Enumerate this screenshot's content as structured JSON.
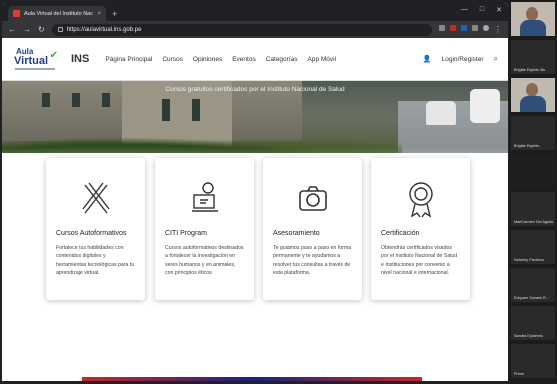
{
  "browser": {
    "tab_title": "Aula Virtual del Instituto Nacion",
    "tab_close": "×",
    "new_tab": "+",
    "url": "https://aulavirtual.ins.gob.pe"
  },
  "site": {
    "logo_aula": "Aula",
    "logo_virtual": "Virtual",
    "logo_org": "INS",
    "nav": [
      "Página Principal",
      "Cursos",
      "Opiniones",
      "Eventos",
      "Categorías",
      "App Móvil"
    ],
    "login_label": "Login/Register"
  },
  "hero": {
    "text": "Cursos gratuitos certificados por el Instituto Nacional de Salud"
  },
  "cards": [
    {
      "icon": "pencil-ruler-icon",
      "title": "Cursos Autoformativos",
      "text": "Fortalece tus habilidades con contenidos digitales y herramientas tecnológicas para tu aprendizaje virtual."
    },
    {
      "icon": "computer-user-icon",
      "title": "CITI Program",
      "text": "Cursos autoformativos destinados a fortalecer la investigación en seres humanos y en animales, con principios éticos."
    },
    {
      "icon": "camera-icon",
      "title": "Asesoramiento",
      "text": "Te guiamos paso a paso en forma permanente y te ayudamos a resolver tus consultas a través de esta plataforma."
    },
    {
      "icon": "award-medal-icon",
      "title": "Certificación",
      "text": "Obtendrás certificados visados por el Instituto Nacional de Salud e Instituciones por convenio a nivel nacional e internacional."
    }
  ],
  "participants": [
    {
      "name": "Brigitte Espiritu Bu"
    },
    {
      "name": "Brigitte Espiritu"
    },
    {
      "name": "MariCarmen Del Aguila"
    },
    {
      "name": "Nohemy Pacheco"
    },
    {
      "name": "Edquam Sonaes R..."
    },
    {
      "name": "Sandra Epidemio"
    },
    {
      "name": "Prime"
    }
  ]
}
